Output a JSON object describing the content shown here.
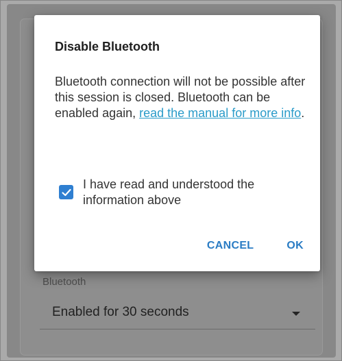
{
  "background": {
    "setting_label": "Bluetooth",
    "setting_value": "Enabled for 30 seconds"
  },
  "dialog": {
    "title": "Disable Bluetooth",
    "body_text": "Bluetooth connection will not be possible after this session is closed. Bluetooth can be enabled again, ",
    "link_text": "read the manual for more info",
    "body_suffix": ".",
    "checkbox": {
      "label": "I have read and understood the information above",
      "checked": true
    },
    "buttons": {
      "cancel": "CANCEL",
      "ok": "OK"
    }
  },
  "colors": {
    "accent": "#2f7fd1",
    "link": "#2a9bc9",
    "button_text": "#2a7cc4"
  }
}
